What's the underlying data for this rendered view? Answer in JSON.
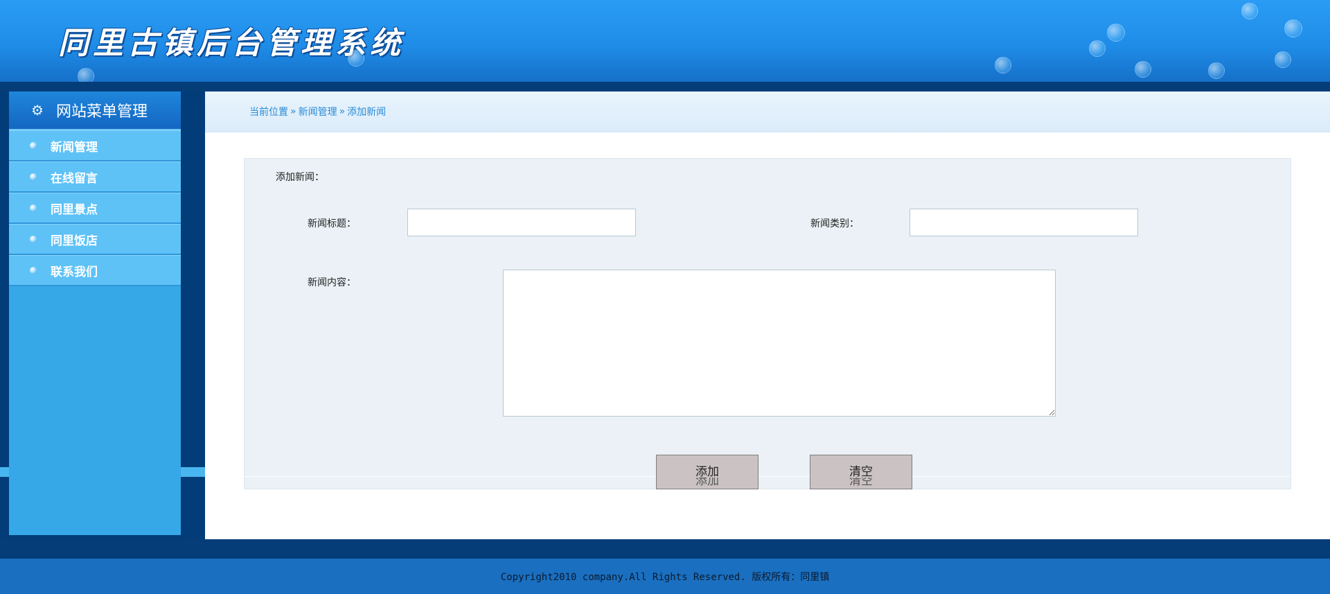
{
  "header": {
    "title": "同里古镇后台管理系统"
  },
  "sidebar": {
    "heading": "网站菜单管理",
    "items": [
      {
        "label": "新闻管理"
      },
      {
        "label": "在线留言"
      },
      {
        "label": "同里景点"
      },
      {
        "label": "同里饭店"
      },
      {
        "label": "联系我们"
      }
    ]
  },
  "breadcrumb": {
    "items": [
      "当前位置",
      "新闻管理",
      "添加新闻"
    ],
    "separator": "»"
  },
  "form": {
    "heading": "添加新闻：",
    "title_label": "新闻标题：",
    "title_value": "",
    "category_label": "新闻类别：",
    "category_value": "",
    "content_label": "新闻内容：",
    "content_value": "",
    "add_button": "添加",
    "clear_button": "清空"
  },
  "footer": {
    "copyright": "Copyright2010 company.All Rights Reserved. 版权所有：同里镇"
  },
  "colors": {
    "header_blue": "#2a9cf4",
    "dark_navy": "#053d79",
    "sidebar_blue": "#36a8e8",
    "menu_item_blue": "#5ec2f7",
    "breadcrumb_link": "#2a8bd5",
    "form_background": "#ebf1f6",
    "button_gray": "#cbc3c3"
  },
  "icons": {
    "sidebar_heading": "gear-icon",
    "menu_bullet": "sphere-bullet-icon",
    "breadcrumb_separator": "double-chevron-right-icon"
  }
}
